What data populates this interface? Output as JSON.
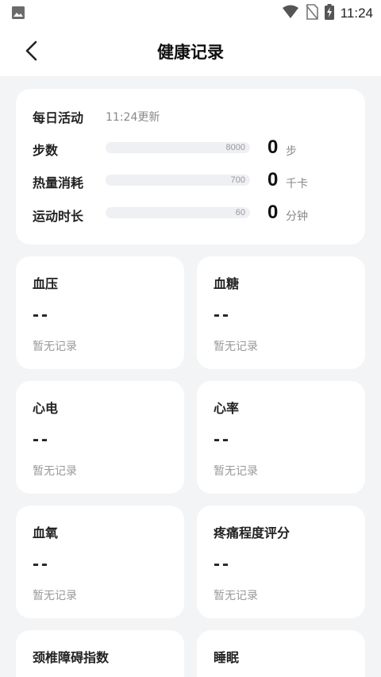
{
  "status_bar": {
    "time": "11:24"
  },
  "header": {
    "title": "健康记录"
  },
  "activity": {
    "title": "每日活动",
    "updated": "11:24更新",
    "rows": [
      {
        "label": "步数",
        "goal": "8000",
        "value": "0",
        "unit": "步",
        "progress": 0
      },
      {
        "label": "热量消耗",
        "goal": "700",
        "value": "0",
        "unit": "千卡",
        "progress": 0
      },
      {
        "label": "运动时长",
        "goal": "60",
        "value": "0",
        "unit": "分钟",
        "progress": 0
      }
    ]
  },
  "metrics": [
    {
      "title": "血压",
      "value": "--",
      "note": "暂无记录"
    },
    {
      "title": "血糖",
      "value": "--",
      "note": "暂无记录"
    },
    {
      "title": "心电",
      "value": "--",
      "note": "暂无记录"
    },
    {
      "title": "心率",
      "value": "--",
      "note": "暂无记录"
    },
    {
      "title": "血氧",
      "value": "--",
      "note": "暂无记录"
    },
    {
      "title": "疼痛程度评分",
      "value": "--",
      "note": "暂无记录"
    },
    {
      "title": "颈椎障碍指数"
    },
    {
      "title": "睡眠"
    }
  ],
  "colors": {
    "background": "#f3f4f6",
    "card": "#ffffff",
    "muted_text": "#999999"
  }
}
